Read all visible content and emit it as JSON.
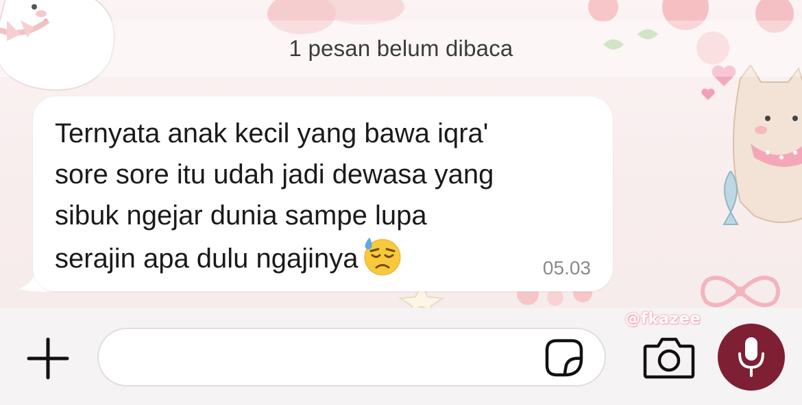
{
  "chat": {
    "unread_banner": "1 pesan belum dibaca",
    "message": {
      "text": "Ternyata anak kecil yang bawa iqra'\nsore sore itu udah jadi dewasa yang\nsibuk ngejar dunia sampe lupa\nserajin apa dulu ngajinya",
      "emoji": "downcast-face-with-sweat",
      "time": "05.03"
    }
  },
  "input_bar": {
    "placeholder": "",
    "value": ""
  },
  "watermark": "@fkazee",
  "colors": {
    "mic_button": "#7e1f34",
    "bubble": "#ffffff",
    "wallpaper": "#f8eded"
  },
  "icons": {
    "add": "plus-icon",
    "sticker": "sticker-icon",
    "camera": "camera-icon",
    "mic": "microphone-icon"
  }
}
